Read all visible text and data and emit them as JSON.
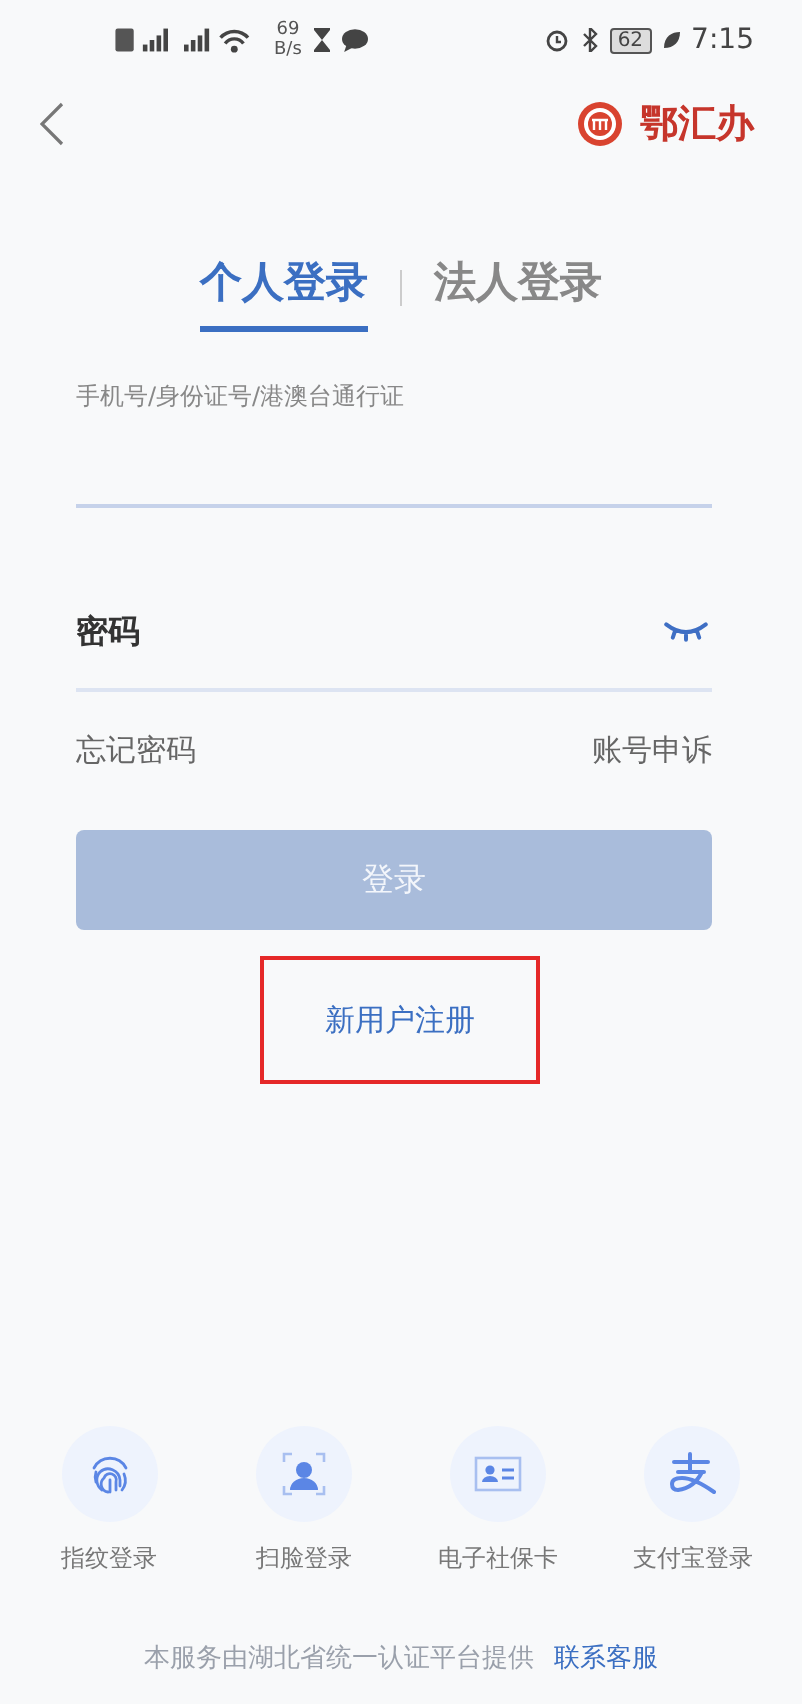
{
  "status_bar": {
    "net_speed": "69",
    "net_unit": "B/s",
    "battery": "62",
    "time": "7:15"
  },
  "header": {
    "app_name": "鄂汇办"
  },
  "tabs": [
    {
      "label": "个人登录",
      "selected": true
    },
    {
      "label": "法人登录",
      "selected": false
    }
  ],
  "account_field": {
    "placeholder": "手机号/身份证号/港澳台通行证"
  },
  "password_field": {
    "placeholder": "密码",
    "visible": false
  },
  "links": {
    "forgot": "忘记密码",
    "appeal": "账号申诉"
  },
  "login_button": {
    "label": "登录",
    "disabled": true
  },
  "register": {
    "label": "新用户注册",
    "highlighted": true
  },
  "quick_logins": [
    {
      "kind": "fingerprint",
      "label": "指纹登录"
    },
    {
      "kind": "face",
      "label": "扫脸登录"
    },
    {
      "kind": "card",
      "label": "电子社保卡"
    },
    {
      "kind": "alipay",
      "label": "支付宝登录"
    }
  ],
  "footer": {
    "text": "本服务由湖北省统一认证平台提供",
    "link": "联系客服"
  }
}
